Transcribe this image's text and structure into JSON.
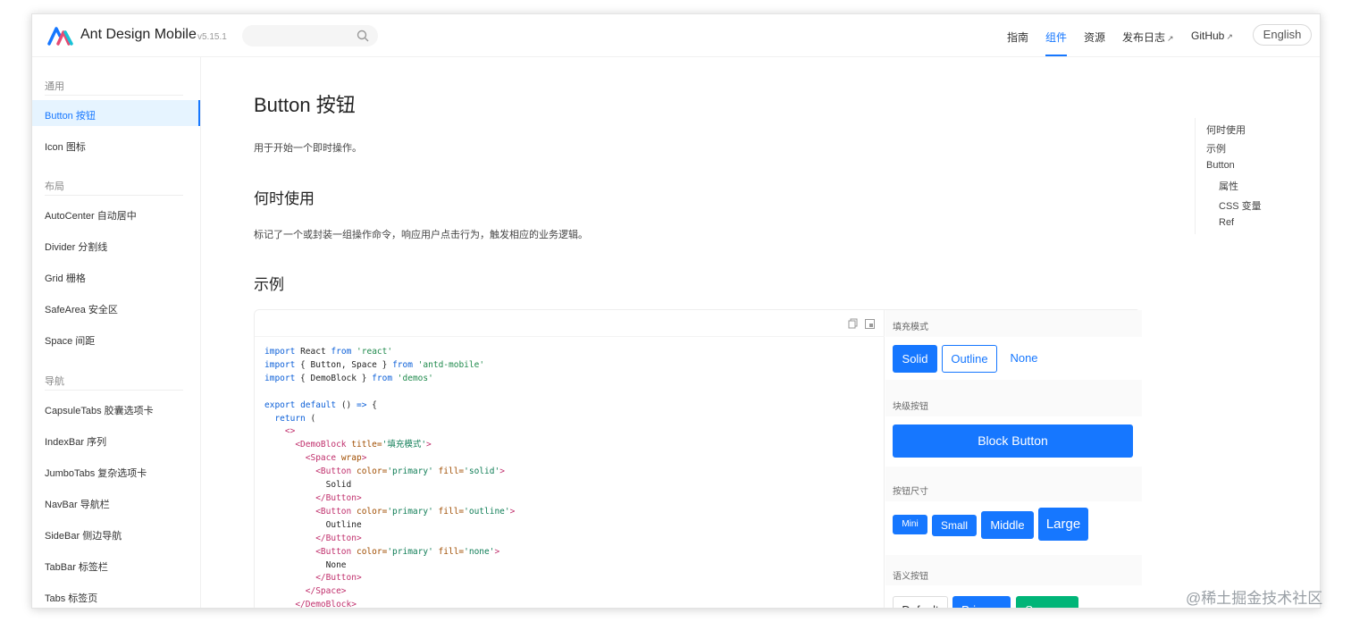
{
  "header": {
    "brand": "Ant Design Mobile",
    "version": "v5.15.1",
    "nav": [
      {
        "label": "指南"
      },
      {
        "label": "组件"
      },
      {
        "label": "资源"
      },
      {
        "label": "发布日志"
      },
      {
        "label": "GitHub"
      }
    ],
    "lang": "English",
    "accent": "#1677ff"
  },
  "sidebar": {
    "groups": [
      {
        "title": "通用",
        "items": [
          "Button 按钮",
          "Icon 图标"
        ]
      },
      {
        "title": "布局",
        "items": [
          "AutoCenter 自动居中",
          "Divider 分割线",
          "Grid 栅格",
          "SafeArea 安全区",
          "Space 间距"
        ]
      },
      {
        "title": "导航",
        "items": [
          "CapsuleTabs 胶囊选项卡",
          "IndexBar 序列",
          "JumboTabs 复杂选项卡",
          "NavBar 导航栏",
          "SideBar 侧边导航",
          "TabBar 标签栏",
          "Tabs 标签页"
        ]
      }
    ],
    "active": "Button 按钮"
  },
  "main": {
    "title": "Button 按钮",
    "intro": "用于开始一个即时操作。",
    "when_title": "何时使用",
    "when_text": "标记了一个或封装一组操作命令，响应用户点击行为，触发相应的业务逻辑。",
    "examples_title": "示例"
  },
  "toc": [
    "何时使用",
    "示例",
    "Button",
    "属性",
    "CSS 变量",
    "Ref"
  ],
  "demo": {
    "code_lines": [
      "import React from 'react'",
      "import { Button, Space } from 'antd-mobile'",
      "import { DemoBlock } from 'demos'",
      "",
      "export default () => {",
      "  return (",
      "    <>",
      "      <DemoBlock title='填充模式'>",
      "        <Space wrap>",
      "          <Button color='primary' fill='solid'>",
      "            Solid",
      "          </Button>",
      "          <Button color='primary' fill='outline'>",
      "            Outline",
      "          </Button>",
      "          <Button color='primary' fill='none'>",
      "            None",
      "          </Button>",
      "        </Space>",
      "      </DemoBlock>"
    ],
    "preview": {
      "fill_title": "填充模式",
      "fill_buttons": [
        "Solid",
        "Outline",
        "None"
      ],
      "block_title": "块级按钮",
      "block_button": "Block Button",
      "size_title": "按钮尺寸",
      "size_buttons": [
        "Mini",
        "Small",
        "Middle",
        "Large"
      ],
      "semantic_title": "语义按钮",
      "semantic_buttons": [
        "Default",
        "Primary",
        "Success"
      ]
    }
  },
  "watermark": "@稀土掘金技术社区"
}
